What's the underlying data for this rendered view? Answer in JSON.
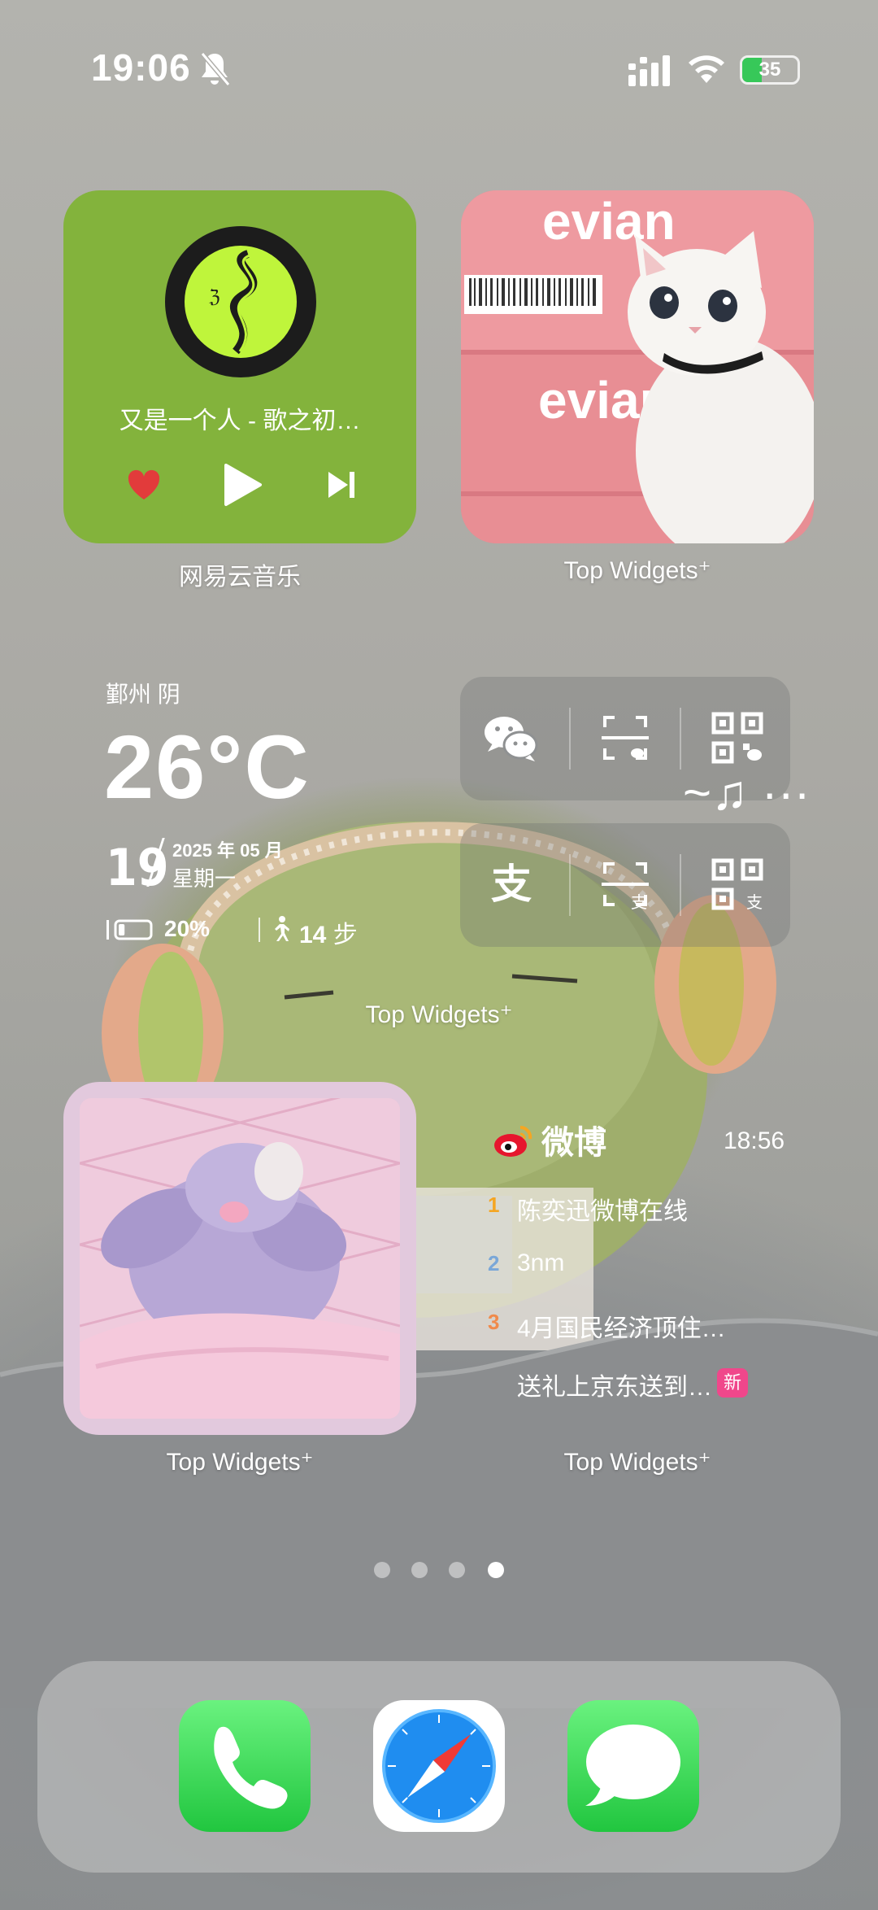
{
  "status_bar": {
    "time": "19:06",
    "battery_percent": "35",
    "battery_level": 0.35,
    "icons": [
      "bell-slash-icon",
      "cellular-signal-icon",
      "wifi-icon",
      "battery-charging-icon"
    ]
  },
  "music_widget": {
    "song": "又是一个人 - 歌之初…",
    "label": "网易云音乐",
    "icons": [
      "heart-icon",
      "play-icon",
      "next-track-icon"
    ],
    "accent_color": "#83b33c"
  },
  "photo_widget_1": {
    "label": "Top Widgets⁺"
  },
  "weather_widget": {
    "location": "鄞州 阴",
    "temperature": "26°C",
    "day": "19",
    "year_month": "2025 年 05 月",
    "weekday": "星期一",
    "battery": "20%",
    "battery_level": 0.2,
    "steps": "14",
    "steps_unit": "步"
  },
  "shortcut_widget": {
    "label": "Top Widgets⁺",
    "row1": [
      "wechat-icon",
      "wechat-scan-icon",
      "wechat-qr-icon"
    ],
    "row2": [
      "alipay-icon",
      "alipay-scan-icon",
      "alipay-qr-icon"
    ]
  },
  "photo_widget_2": {
    "label": "Top Widgets⁺"
  },
  "weibo_widget": {
    "title": "微博",
    "time": "18:56",
    "label": "Top Widgets⁺",
    "items": [
      {
        "rank": "1",
        "text": "陈奕迅微博在线",
        "rank_color": "#f5a623"
      },
      {
        "rank": "2",
        "text": "3nm",
        "rank_color": "#7aa7d8"
      },
      {
        "rank": "3",
        "text": "4月国民经济顶住…",
        "rank_color": "#f08a4b"
      },
      {
        "rank": "",
        "text": "送礼上京东送到…",
        "badge": "新"
      }
    ]
  },
  "page_dots": {
    "count": 4,
    "active": 4
  },
  "dock": {
    "apps": [
      {
        "name": "Phone",
        "icon": "phone-icon"
      },
      {
        "name": "Safari",
        "icon": "safari-compass-icon"
      },
      {
        "name": "Messages",
        "icon": "messages-icon"
      }
    ]
  }
}
